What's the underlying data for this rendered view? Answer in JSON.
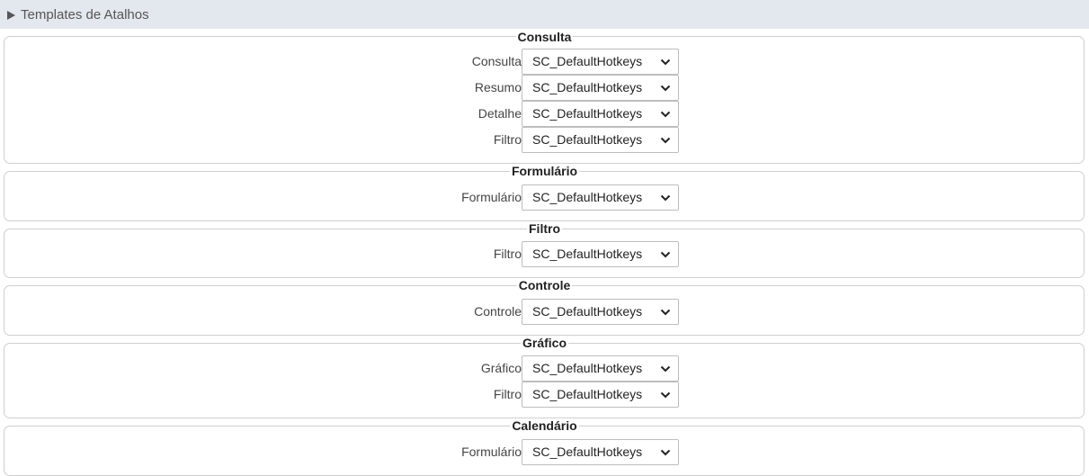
{
  "header": {
    "title": "Templates de Atalhos"
  },
  "groups": [
    {
      "title": "Consulta",
      "rows": [
        {
          "label": "Consulta",
          "value": "SC_DefaultHotkeys"
        },
        {
          "label": "Resumo",
          "value": "SC_DefaultHotkeys"
        },
        {
          "label": "Detalhe",
          "value": "SC_DefaultHotkeys"
        },
        {
          "label": "Filtro",
          "value": "SC_DefaultHotkeys"
        }
      ]
    },
    {
      "title": "Formulário",
      "rows": [
        {
          "label": "Formulário",
          "value": "SC_DefaultHotkeys"
        }
      ]
    },
    {
      "title": "Filtro",
      "rows": [
        {
          "label": "Filtro",
          "value": "SC_DefaultHotkeys"
        }
      ]
    },
    {
      "title": "Controle",
      "rows": [
        {
          "label": "Controle",
          "value": "SC_DefaultHotkeys"
        }
      ]
    },
    {
      "title": "Gráfico",
      "rows": [
        {
          "label": "Gráfico",
          "value": "SC_DefaultHotkeys"
        },
        {
          "label": "Filtro",
          "value": "SC_DefaultHotkeys"
        }
      ]
    },
    {
      "title": "Calendário",
      "rows": [
        {
          "label": "Formulário",
          "value": "SC_DefaultHotkeys"
        }
      ]
    }
  ]
}
